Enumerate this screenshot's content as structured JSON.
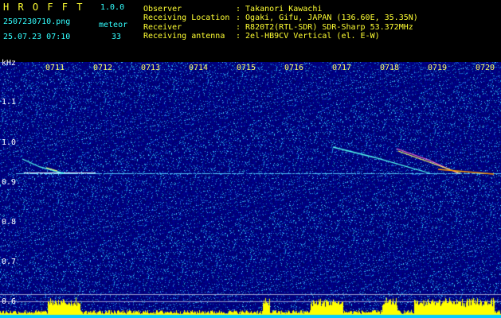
{
  "app": {
    "title": "H R O F F T",
    "version": "1.0.0",
    "filename": "2507230710.png",
    "datetime": "25.07.23 07:10",
    "counter_label": "meteor",
    "counter_value": "33"
  },
  "info": [
    {
      "label": "Observer",
      "value": ": Takanori Kawachi"
    },
    {
      "label": "Receiving Location",
      "value": ": Ogaki, Gifu, JAPAN (136.60E, 35.35N)"
    },
    {
      "label": "Receiver",
      "value": ": R820T2(RTL-SDR) SDR-Sharp 53.372MHz"
    },
    {
      "label": "Receiving antenna",
      "value": ": 2el-HB9CV Vertical (el. E-W)"
    }
  ],
  "axis": {
    "y_unit": "kHz",
    "y_ticks": [
      "1.1",
      "1.0",
      "0.9",
      "0.8",
      "0.7",
      "0.6"
    ],
    "x_ticks": [
      "0711",
      "0712",
      "0713",
      "0714",
      "0715",
      "0716",
      "0717",
      "0718",
      "0719",
      "0720"
    ]
  },
  "colors": {
    "header_yellow": "#ffff33",
    "header_cyan": "#33ffff",
    "background_blue": "#000088",
    "signal_cyan": "#33ffff",
    "signal_yellow": "#ffff00"
  }
}
